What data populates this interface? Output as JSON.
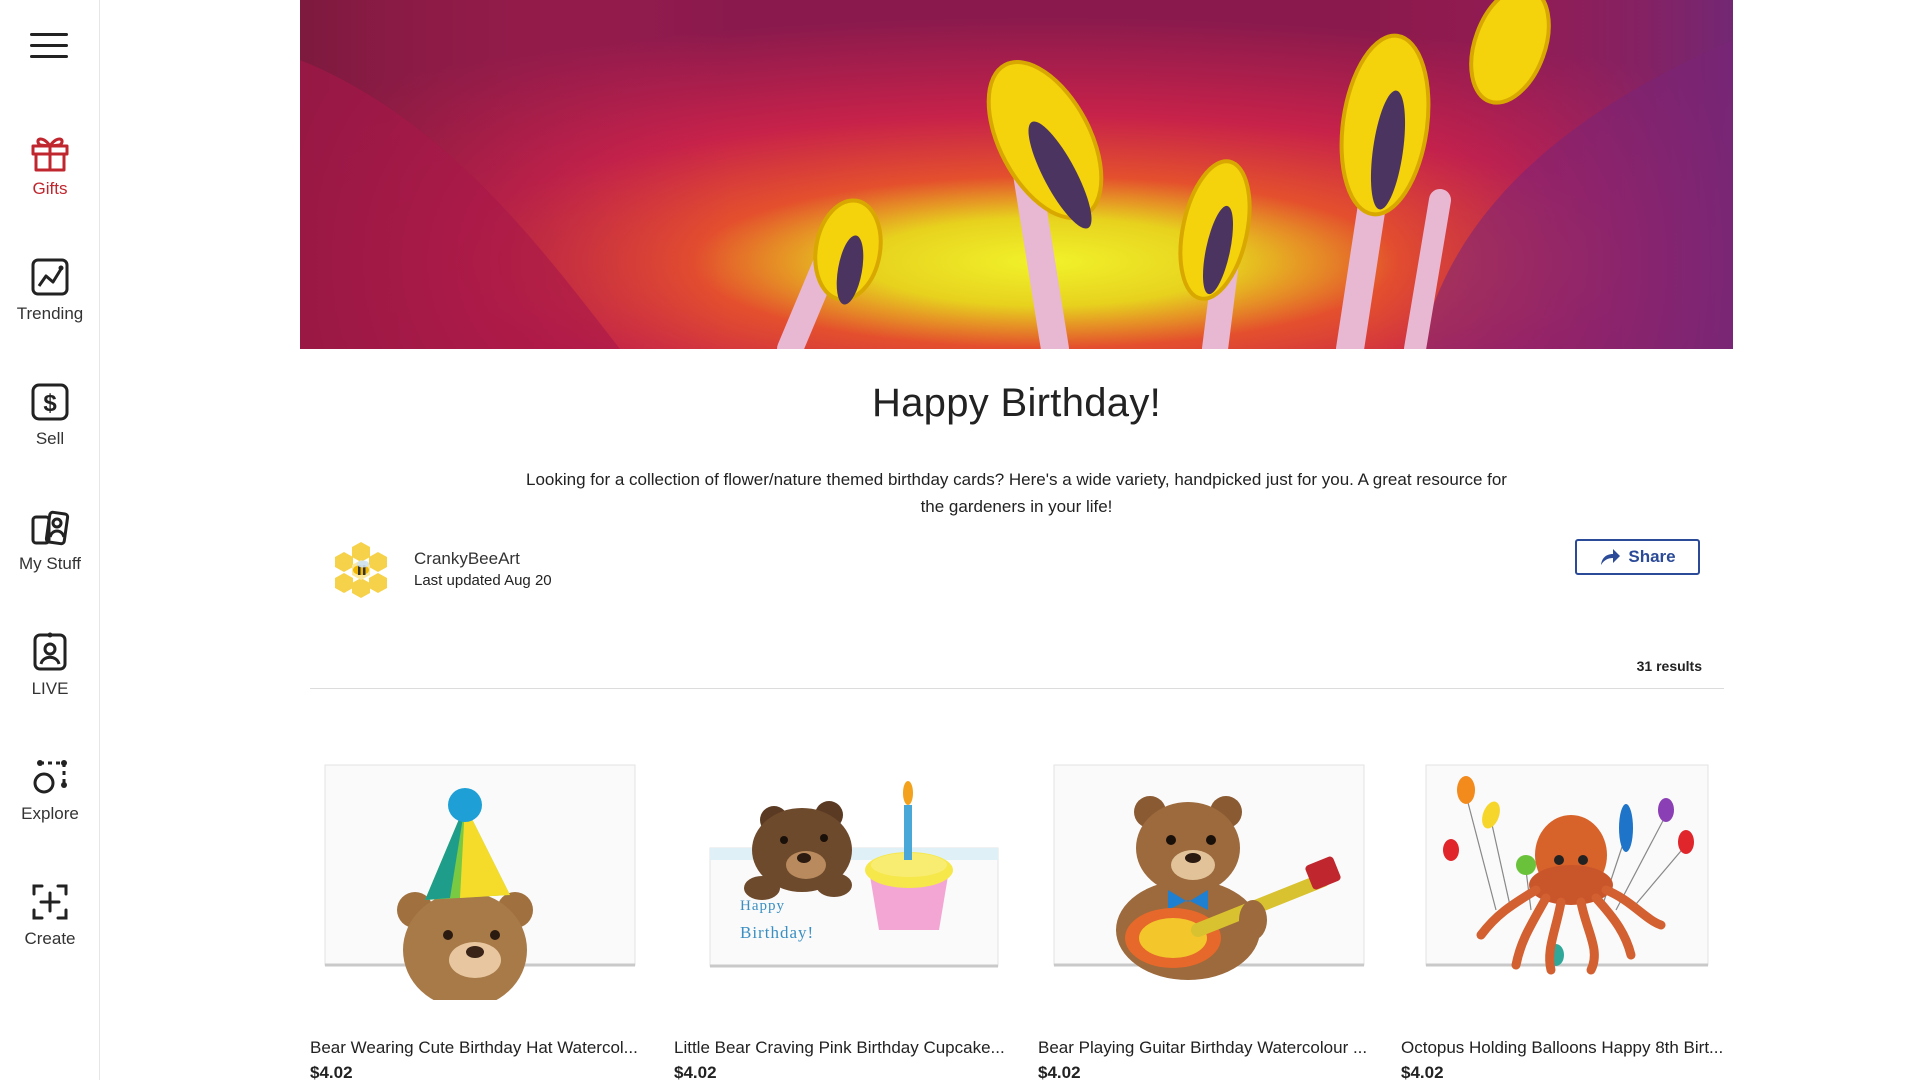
{
  "sidebar": {
    "menu_icon": "hamburger-menu-icon",
    "items": [
      {
        "label": "Gifts",
        "icon": "gift-icon",
        "active": true
      },
      {
        "label": "Trending",
        "icon": "trending-chart-icon",
        "active": false
      },
      {
        "label": "Sell",
        "icon": "dollar-icon",
        "active": false
      },
      {
        "label": "My Stuff",
        "icon": "my-stuff-icon",
        "active": false
      },
      {
        "label": "LIVE",
        "icon": "live-person-icon",
        "active": false
      },
      {
        "label": "Explore",
        "icon": "explore-icon",
        "active": false
      },
      {
        "label": "Create",
        "icon": "create-plus-icon",
        "active": false
      }
    ]
  },
  "collection": {
    "title": "Happy Birthday!",
    "description": "Looking for a collection of flower/nature themed birthday cards? Here's a wide variety, handpicked just for you. A great resource for the gardeners in your life!",
    "author": "CrankyBeeArt",
    "updated": "Last updated Aug 20",
    "share_label": "Share",
    "results": "31 results"
  },
  "products": [
    {
      "name": "Bear Wearing Cute Birthday Hat Watercol...",
      "price": "$4.02"
    },
    {
      "name": "Little Bear Craving Pink Birthday Cupcake...",
      "price": "$4.02",
      "card_text_1": "Happy",
      "card_text_2": "Birthday!"
    },
    {
      "name": "Bear Playing Guitar Birthday Watercolour ...",
      "price": "$4.02"
    },
    {
      "name": "Octopus Holding Balloons Happy 8th Birt...",
      "price": "$4.02"
    }
  ],
  "colors": {
    "accent_red": "#c0262d",
    "share_blue": "#2b4a97"
  }
}
